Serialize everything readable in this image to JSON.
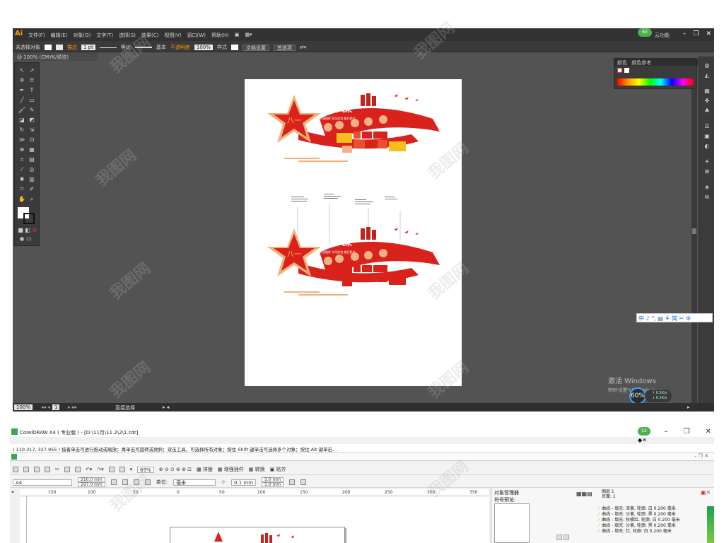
{
  "illustrator": {
    "logo": "Ai",
    "menus": [
      "文件(F)",
      "编辑(E)",
      "对象(O)",
      "文字(T)",
      "选择(S)",
      "效果(C)",
      "视图(V)",
      "窗口(W)",
      "帮助(H)"
    ],
    "badge": "60",
    "badge_label": "云功能",
    "control_bar": {
      "selection": "未选择对象",
      "stroke_label": "描边",
      "stroke_width": "1 pt",
      "profile_label": "等比",
      "brush_label": "基本",
      "opacity_label": "不透明度",
      "opacity_value": "100%",
      "style_label": "样式",
      "doc_setup": "文档设置",
      "prefs": "首选项"
    },
    "doc_tab": "@ 100% (CMYK/预览)",
    "zoom": "100%",
    "page_num": "1",
    "status_mode": "直接选择",
    "color_panel": {
      "tab1": "颜色",
      "tab2": "颜色参考"
    },
    "ime_text": "中 ♪ °, ▤ ⚘ 简 ✂ ⚙",
    "activate": {
      "line1": "激活 Windows",
      "line2": "转到\"设置\"以激活 Windows。"
    },
    "perf": {
      "percent": "60",
      "up": "0.5K/s",
      "down": "0.5K/s"
    }
  },
  "artwork": {
    "title": "军人风采",
    "slogan": "听党指挥  作风优良  能打胜仗",
    "star_number": "八一"
  },
  "coreldraw": {
    "title": "CorelDRAW X4 ( 专业版 ) - [D:\\11月\\11.2\\2\\1.cdr]",
    "badge": "52",
    "status": "( 110.317, 327.955 )    接着单击可进行拖动或缩放；再单击可旋转或倾斜；双击工具，可选择所有对象；按住 Shift 键单击可选择多个对象；按住 Alt 键单击...",
    "zoom": "69%",
    "toolbar1_items": [
      "排版",
      "增强插件",
      "转换",
      "贴齐"
    ],
    "page_size": "A4",
    "width": "210.0 mm",
    "height": "297.0 mm",
    "units_label": "单位:",
    "units": "毫米",
    "nudge": "0.1 mm",
    "dup_x": "5.0 mm",
    "dup_y": "5.0 mm",
    "ruler_ticks": [
      "150",
      "100",
      "50",
      "0",
      "50",
      "100",
      "150",
      "200",
      "250",
      "300",
      "350"
    ],
    "object_manager": {
      "title": "对象管理器",
      "subtitle": "符号预览:",
      "layer1": "图层 1",
      "page": "页面: 1",
      "items": [
        "曲线 - 填充: 深黄, 轮廓: 白  0.200 毫米",
        "曲线 - 填充: 沙黄, 轮廓: 黑  0.200 毫米",
        "曲线 - 填充: 秋橘红, 轮廓: 白  0.200 毫米",
        "曲线 - 填充: 沙黄, 轮廓: 黑  0.200 毫米",
        "曲线 - 填充: 红, 轮廓: 白  0.200 毫米"
      ]
    }
  },
  "watermark": "我图网"
}
